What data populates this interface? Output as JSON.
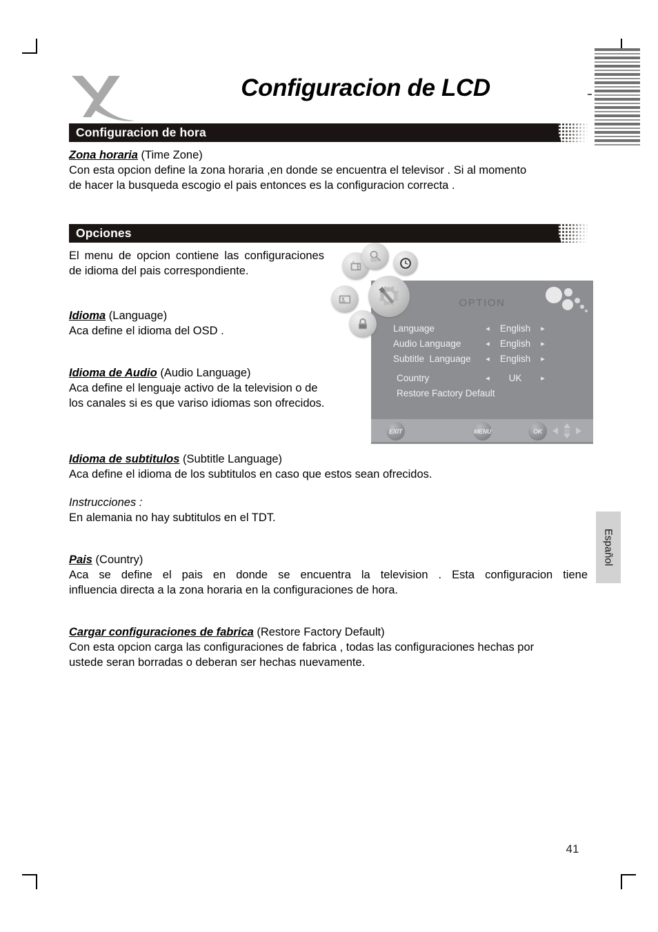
{
  "document": {
    "title": "Configuracion de LCD",
    "page_number": "41",
    "side_tab_label": "Español",
    "logo": "x-logo"
  },
  "sections": [
    {
      "bar_label": "Configuracion de hora",
      "heading": "Zona horaria",
      "heading_suffix": "(Time Zone)",
      "body_line1": "Con esta opcion define la zona horaria ,en donde se encuentra el televisor . Si al momento",
      "body_line2": "de hacer la busqueda escogio el pais entonces es la configuracion correcta ."
    },
    {
      "bar_label": "Opciones"
    }
  ],
  "opciones": {
    "intro": "El menu de opcion contiene las configuraciones de idioma del pais correspondiente.",
    "items": [
      {
        "heading": "Idioma",
        "heading_suffix": "(Language)",
        "body": "Aca define el idioma del OSD ."
      },
      {
        "heading": "Idioma de Audio",
        "heading_suffix": "(Audio Language)",
        "body": "Aca define el lenguaje activo de la television o de los canales si es que variso idiomas son ofrecidos."
      },
      {
        "heading": "Idioma de subtitulos",
        "heading_suffix": "(Subtitle Language)",
        "body": "Aca define el idioma de los subtitulos  en caso que estos sean ofrecidos."
      },
      {
        "heading": "Pais",
        "heading_suffix": "(Country)",
        "body_line1": "Aca se define el pais en donde se encuentra la television . Esta configuracion tiene",
        "body_line2": "influencia directa a la zona horaria en la configuraciones de hora."
      },
      {
        "heading": "Cargar configuraciones de fabrica",
        "heading_suffix": "(Restore Factory Default)",
        "body_line1": "Con esta opcion carga las configuraciones de fabrica , todas las configuraciones hechas por",
        "body_line2": "ustede seran borradas o deberan ser hechas nuevamente."
      }
    ],
    "note": {
      "label": "Instrucciones :",
      "text": "En alemania no hay subtitulos en el TDT."
    }
  },
  "osd": {
    "title": "OPTION",
    "rows": [
      {
        "label": "Language",
        "value": "English",
        "arrow_left": "◂",
        "arrow_right": "▸"
      },
      {
        "label": "Audio Language",
        "value": "English",
        "arrow_left": "◂",
        "arrow_right": "▸"
      },
      {
        "label": "Subtitle  Language",
        "value": "English",
        "arrow_left": "◂",
        "arrow_right": "▸"
      },
      {
        "label": "Country",
        "value": "UK",
        "arrow_left": "◂",
        "arrow_right": "▸"
      }
    ],
    "restore_label": "Restore Factory Default",
    "buttons": {
      "exit": "EXIT",
      "menu": "MENU",
      "ok": "OK"
    },
    "colors": {
      "panel_bg": "#8d8e92",
      "footer_bg": "#a9aaae",
      "text": "#f2f2f2",
      "title": "#6d6e72"
    },
    "icons": [
      "settings-wrench-gear-icon",
      "picture-icon",
      "tuner-icon",
      "channel-scan-icon",
      "clock-icon",
      "lock-icon"
    ]
  }
}
